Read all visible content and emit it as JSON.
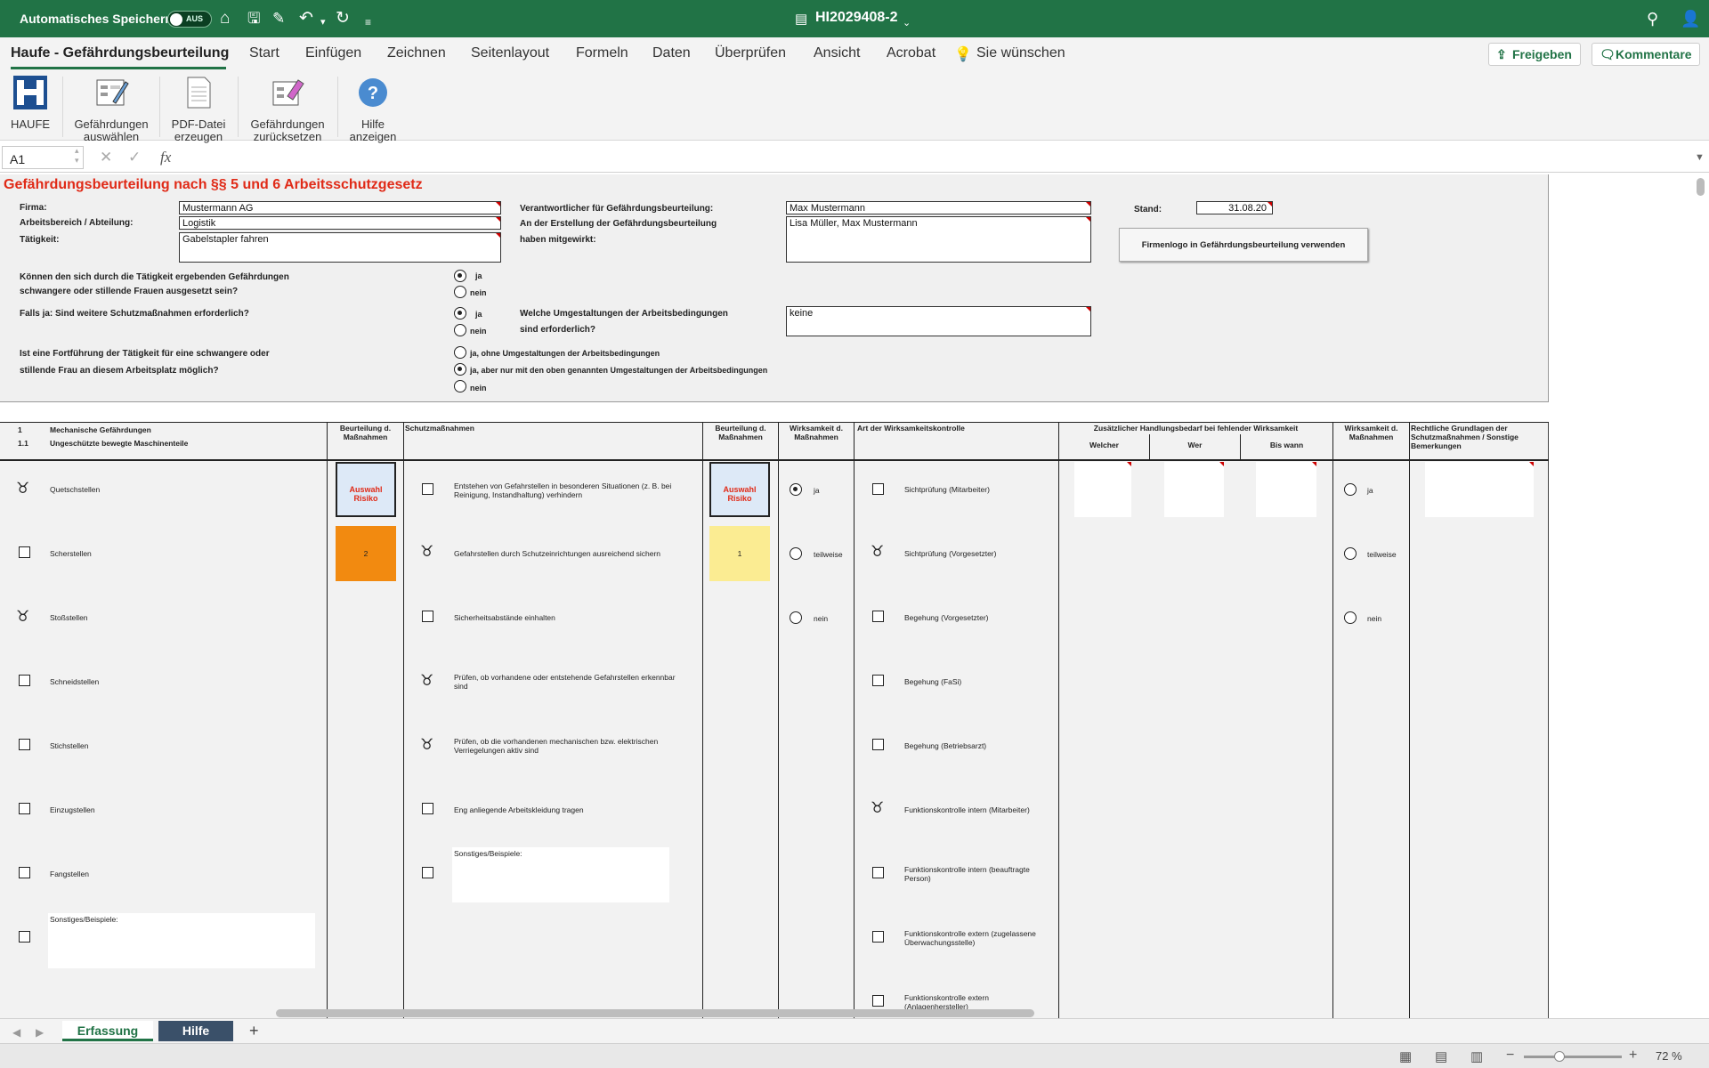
{
  "titlebar": {
    "autosave_label": "Automatisches Speichern",
    "autosave_state": "AUS",
    "document_title": "HI2029408-2",
    "colors": {
      "bar": "#217346"
    }
  },
  "menu": {
    "tabs": [
      "Haufe - Gefährdungsbeurteilung",
      "Start",
      "Einfügen",
      "Zeichnen",
      "Seitenlayout",
      "Formeln",
      "Daten",
      "Überprüfen",
      "Ansicht",
      "Acrobat",
      "Sie wünschen"
    ],
    "share": "Freigeben",
    "comments": "Kommentare"
  },
  "ribbon": {
    "haufe": "HAUFE",
    "select_hazards": [
      "Gefährdungen",
      "auswählen"
    ],
    "pdf": [
      "PDF-Datei",
      "erzeugen"
    ],
    "reset": [
      "Gefährdungen",
      "zurücksetzen"
    ],
    "help": [
      "Hilfe",
      "anzeigen"
    ]
  },
  "formula_bar": {
    "cell_ref": "A1",
    "fx": "fx",
    "content": ""
  },
  "form": {
    "title": "Gefährdungsbeurteilung nach §§ 5 und 6 Arbeitsschutzgesetz",
    "firma_label": "Firma:",
    "firma_value": "Mustermann AG",
    "bereich_label": "Arbeitsbereich / Abteilung:",
    "bereich_value": "Logistik",
    "taetigkeit_label": "Tätigkeit:",
    "taetigkeit_value": "Gabelstapler fahren",
    "verantwortlich_label": "Verantwortlicher für Gefährdungsbeurteilung:",
    "verantwortlich_value": "Max Mustermann",
    "mitgewirkt_label1": "An der Erstellung der Gefährdungsbeurteilung",
    "mitgewirkt_label2": "haben mitgewirkt:",
    "mitgewirkt_value": "Lisa Müller, Max Mustermann",
    "stand_label": "Stand:",
    "stand_value": "31.08.20",
    "logo_button": "Firmenlogo in Gefährdungsbeurteilung verwenden",
    "q1_line1": "Können den sich durch die Tätigkeit ergebenden Gefährdungen",
    "q1_line2": "schwangere oder stillende Frauen ausgesetzt sein?",
    "q2": "Falls ja: Sind weitere Schutzmaßnahmen erforderlich?",
    "q3_line1": "Welche Umgestaltungen der Arbeitsbedingungen",
    "q3_line2": "sind erforderlich?",
    "q3_value": "keine",
    "q4_line1": "Ist eine Fortführung der Tätigkeit für eine schwangere oder",
    "q4_line2": "stillende Frau an diesem Arbeitsplatz möglich?",
    "opt_ja": "ja",
    "opt_nein": "nein",
    "opt_ja_ohne": "ja, ohne Umgestaltungen der Arbeitsbedingungen",
    "opt_ja_aber": "ja, aber nur mit den oben genannten Umgestaltungen der Arbeitsbedingungen",
    "q1_selected": "ja",
    "q2_selected": "ja",
    "q4_selected": "ja, aber nur mit den oben genannten Umgestaltungen der Arbeitsbedingungen"
  },
  "table": {
    "sec_num": "1",
    "sec_title": "Mechanische Gefährdungen",
    "sub_num": "1.1",
    "sub_title": "Ungeschützte bewegte Maschinenteile",
    "h_beurteilung": [
      "Beurteilung d.",
      "Maßnahmen"
    ],
    "h_schutz": "Schutzmaßnahmen",
    "h_beurteilung2": [
      "Beurteilung d.",
      "Maßnahmen"
    ],
    "h_wirksamkeit": [
      "Wirksamkeit d.",
      "Maßnahmen"
    ],
    "h_kontrolle": "Art der Wirksamkeitskontrolle",
    "h_zusatz": "Zusätzlicher Handlungsbedarf bei fehlender Wirksamkeit",
    "h_welcher": "Welcher",
    "h_wer": "Wer",
    "h_biswann": "Bis wann",
    "h_wirksamkeit2": [
      "Wirksamkeit d.",
      "Maßnahmen"
    ],
    "h_recht": [
      "Rechtliche Grundlagen der",
      "Schutzmaßnahmen / Sonstige",
      "Bemerkungen"
    ],
    "hazards": [
      {
        "label": "Quetschstellen",
        "checked": true
      },
      {
        "label": "Scherstellen",
        "checked": false
      },
      {
        "label": "Stoßstellen",
        "checked": true
      },
      {
        "label": "Schneidstellen",
        "checked": false
      },
      {
        "label": "Stichstellen",
        "checked": false
      },
      {
        "label": "Einzugstellen",
        "checked": false
      },
      {
        "label": "Fangstellen",
        "checked": false
      },
      {
        "label": "Sonstiges/Beispiele:",
        "checked": false
      }
    ],
    "measures": [
      {
        "label": "Entstehen von Gefahrstellen in besonderen Situationen (z. B. bei Reinigung, Instandhaltung) verhindern",
        "checked": false
      },
      {
        "label": "Gefahrstellen durch Schutzeinrichtungen ausreichend sichern",
        "checked": true
      },
      {
        "label": "Sicherheitsabstände einhalten",
        "checked": false
      },
      {
        "label": "Prüfen, ob vorhandene oder entstehende Gefahrstellen erkennbar sind",
        "checked": true
      },
      {
        "label": "Prüfen, ob die vorhandenen mechanischen bzw. elektrischen Verriegelungen aktiv sind",
        "checked": true
      },
      {
        "label": "Eng anliegende Arbeitskleidung tragen",
        "checked": false
      },
      {
        "label": "Sonstiges/Beispiele:",
        "checked": false
      }
    ],
    "risk_before": {
      "select_label": "Auswahl Risiko",
      "value": "2",
      "color": "#f28a10"
    },
    "risk_after": {
      "select_label": "Auswahl Risiko",
      "value": "1",
      "color": "#fbec92"
    },
    "effect": [
      {
        "label": "ja",
        "selected": true
      },
      {
        "label": "teilweise",
        "selected": false
      },
      {
        "label": "nein",
        "selected": false
      }
    ],
    "controls": [
      {
        "label": "Sichtprüfung (Mitarbeiter)",
        "checked": false
      },
      {
        "label": "Sichtprüfung (Vorgesetzter)",
        "checked": true
      },
      {
        "label": "Begehung (Vorgesetzter)",
        "checked": false
      },
      {
        "label": "Begehung (FaSi)",
        "checked": false
      },
      {
        "label": "Begehung (Betriebsarzt)",
        "checked": false
      },
      {
        "label": "Funktionskontrolle intern (Mitarbeiter)",
        "checked": true
      },
      {
        "label": "Funktionskontrolle intern (beauftragte Person)",
        "checked": false
      },
      {
        "label": "Funktionskontrolle extern (zugelassene Überwachungsstelle)",
        "checked": false
      },
      {
        "label": "Funktionskontrolle extern (Anlagenhersteller)",
        "checked": false
      }
    ],
    "effect2": [
      {
        "label": "ja",
        "selected": false
      },
      {
        "label": "teilweise",
        "selected": false
      },
      {
        "label": "nein",
        "selected": false
      }
    ]
  },
  "sheet_tabs": {
    "active": "Erfassung",
    "other": "Hilfe",
    "add": "+"
  },
  "status": {
    "zoom": "72 %"
  }
}
